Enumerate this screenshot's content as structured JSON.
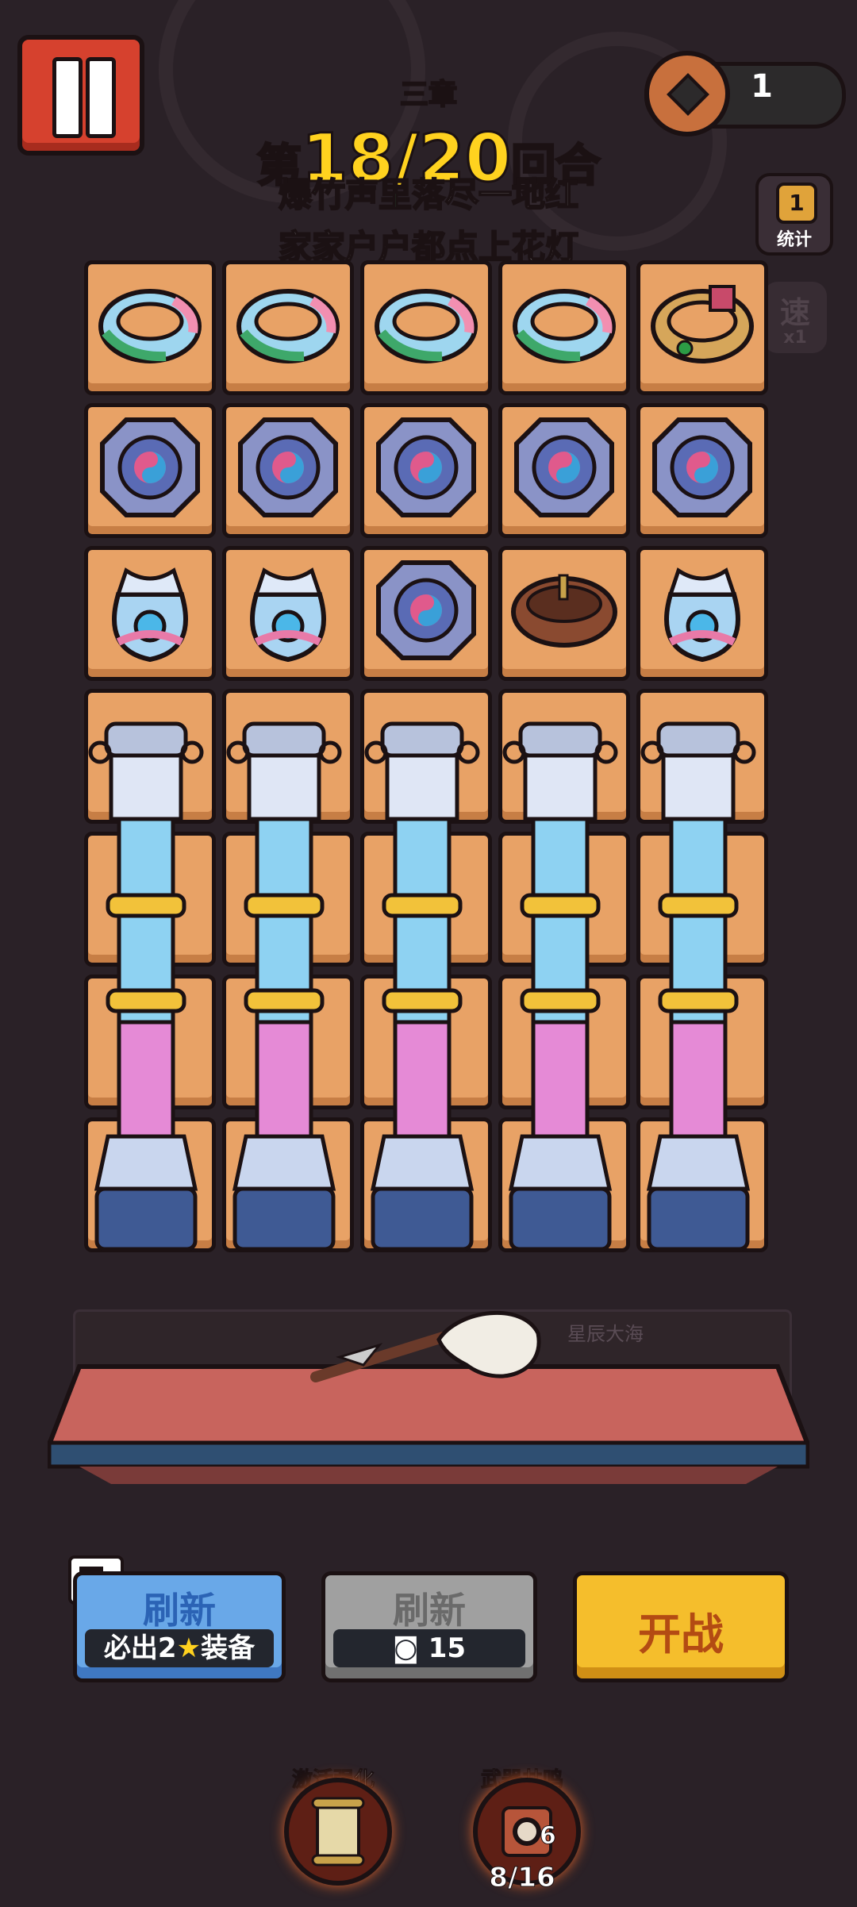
{
  "header": {
    "chapter": "三章",
    "round_prefix": "第",
    "round_value": "18/20",
    "round_suffix": "回合",
    "lyric_line1_highlight": "爆竹声里落",
    "lyric_line1_rest": "尽一地红",
    "lyric_line2": "家家户户都点上花灯",
    "coin_count": "1"
  },
  "side": {
    "stats_label": "统计",
    "stats_icon": "podium-icon",
    "speed_label": "速",
    "speed_value": "x1"
  },
  "grid": {
    "rows": [
      [
        "jade-bracelet",
        "jade-bracelet",
        "jade-bracelet",
        "jade-bracelet",
        "gold-ring"
      ],
      [
        "taiji-disc",
        "taiji-disc",
        "taiji-disc",
        "taiji-disc",
        "taiji-disc"
      ],
      [
        "pouch",
        "pouch",
        "taiji-disc",
        "leather-bracer",
        "pouch"
      ]
    ],
    "pillar_columns": 5,
    "pillar_rows": 4
  },
  "arena": {
    "weapon_name": "whisk-weapon",
    "hidden_label": "星辰大海"
  },
  "buttons": {
    "ad_refresh_label": "刷新",
    "ad_refresh_sub_prefix": "必出",
    "ad_refresh_sub_num": "2",
    "ad_refresh_sub_suffix": "装备",
    "coin_refresh_label": "刷新",
    "coin_refresh_cost": "15",
    "start_label": "开战"
  },
  "bottom": {
    "activate_label": "激活强化",
    "resonance_label": "武器共鸣",
    "resonance_level": "6",
    "resonance_progress": "8/16"
  },
  "colors": {
    "accent_yellow": "#ffd21f",
    "lyric_green": "#46c46f",
    "slot_orange": "#e8a266",
    "button_blue": "#69a8e8",
    "button_yellow": "#f5be2c"
  }
}
